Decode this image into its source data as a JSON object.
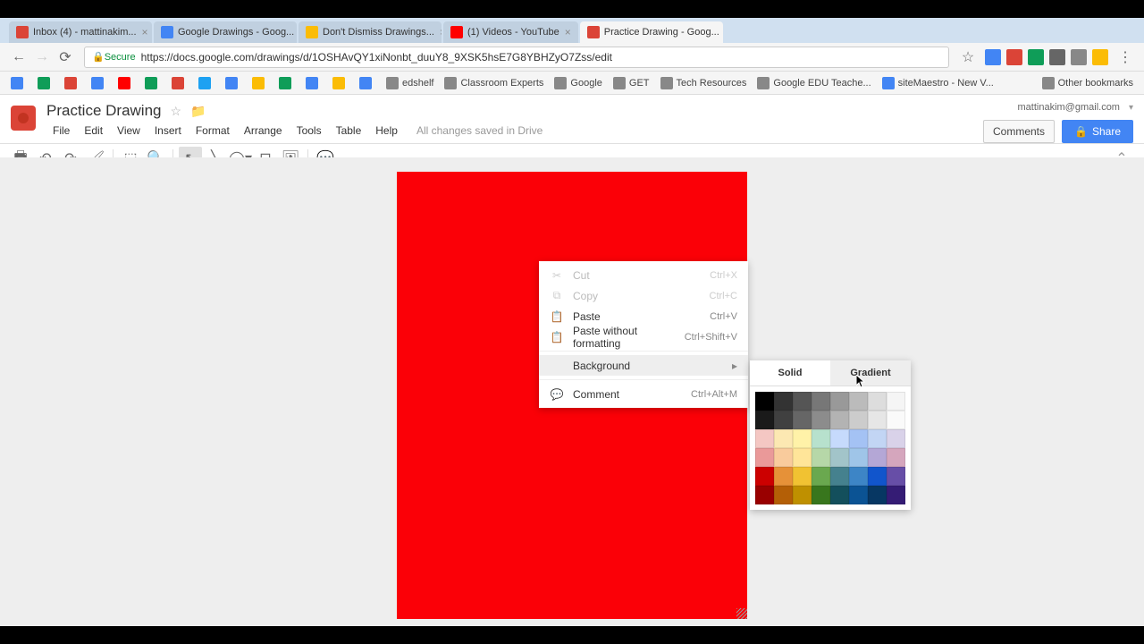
{
  "browser": {
    "tabs": [
      {
        "label": "Inbox (4) - mattinakim...",
        "favicon": "#db4437"
      },
      {
        "label": "Google Drawings - Goog...",
        "favicon": "#4285f4"
      },
      {
        "label": "Don't Dismiss Drawings...",
        "favicon": "#fbbc05"
      },
      {
        "label": "(1) Videos - YouTube",
        "favicon": "#ff0000"
      },
      {
        "label": "Practice Drawing - Goog...",
        "favicon": "#db4437",
        "active": true
      }
    ],
    "secure_label": "Secure",
    "url": "https://docs.google.com/drawings/d/1OSHAvQY1xiNonbt_duuY8_9XSK5hsE7G8YBHZyO7Zss/edit",
    "bookmarks": [
      {
        "label": "",
        "color": "#4285f4"
      },
      {
        "label": "",
        "color": "#0f9d58"
      },
      {
        "label": "",
        "color": "#db4437"
      },
      {
        "label": "",
        "color": "#4285f4"
      },
      {
        "label": "",
        "color": "#ff0000"
      },
      {
        "label": "",
        "color": "#0f9d58"
      },
      {
        "label": "",
        "color": "#db4437"
      },
      {
        "label": "",
        "color": "#1da1f2"
      },
      {
        "label": "",
        "color": "#4285f4"
      },
      {
        "label": "",
        "color": "#fbbc05"
      },
      {
        "label": "",
        "color": "#0f9d58"
      },
      {
        "label": "",
        "color": "#4285f4"
      },
      {
        "label": "",
        "color": "#fbbc05"
      },
      {
        "label": "",
        "color": "#4285f4"
      },
      {
        "label": "edshelf",
        "color": "#888"
      },
      {
        "label": "Classroom Experts",
        "color": "#888"
      },
      {
        "label": "Google",
        "color": "#888"
      },
      {
        "label": "GET",
        "color": "#888"
      },
      {
        "label": "Tech Resources",
        "color": "#888"
      },
      {
        "label": "Google EDU Teache...",
        "color": "#888"
      },
      {
        "label": "siteMaestro - New V...",
        "color": "#4285f4"
      }
    ],
    "other_bookmarks": "Other bookmarks"
  },
  "app": {
    "doc_title": "Practice Drawing",
    "menus": [
      "File",
      "Edit",
      "View",
      "Insert",
      "Format",
      "Arrange",
      "Tools",
      "Table",
      "Help"
    ],
    "save_status": "All changes saved in Drive",
    "user_email": "mattinakim@gmail.com",
    "comments_label": "Comments",
    "share_label": "Share"
  },
  "context_menu": {
    "items": [
      {
        "label": "Cut",
        "shortcut": "Ctrl+X",
        "disabled": true,
        "icon": "cut"
      },
      {
        "label": "Copy",
        "shortcut": "Ctrl+C",
        "disabled": true,
        "icon": "copy"
      },
      {
        "label": "Paste",
        "shortcut": "Ctrl+V",
        "icon": "paste"
      },
      {
        "label": "Paste without formatting",
        "shortcut": "Ctrl+Shift+V",
        "icon": "paste"
      },
      {
        "sep": true
      },
      {
        "label": "Background",
        "submenu": true,
        "hover": true
      },
      {
        "sep": true
      },
      {
        "label": "Comment",
        "shortcut": "Ctrl+Alt+M",
        "icon": "comment"
      }
    ]
  },
  "color_picker": {
    "tab_solid": "Solid",
    "tab_gradient": "Gradient",
    "rows": [
      [
        "#000000",
        "#333333",
        "#555555",
        "#777777",
        "#999999",
        "#bbbbbb",
        "#dddddd",
        "#f5f5f5"
      ],
      [
        "#1a1a1a",
        "#404040",
        "#666666",
        "#8c8c8c",
        "#b3b3b3",
        "#cccccc",
        "#e6e6e6",
        "#fafafa"
      ],
      [
        "#f4c7c3",
        "#fce8b2",
        "#fff2a8",
        "#b7e1cd",
        "#c6dafc",
        "#a4c2f4",
        "#c2d5f4",
        "#d9d2e9"
      ],
      [
        "#ea9999",
        "#f9cb9c",
        "#ffe599",
        "#b6d7a8",
        "#a2c4c9",
        "#9fc5e8",
        "#b4a7d6",
        "#d5a6bd"
      ],
      [
        "#cc0000",
        "#e69138",
        "#f1c232",
        "#6aa84f",
        "#45818e",
        "#3d85c6",
        "#1155cc",
        "#674ea7"
      ],
      [
        "#990000",
        "#b45f06",
        "#bf9000",
        "#38761d",
        "#134f5c",
        "#0b5394",
        "#073763",
        "#351c75"
      ]
    ]
  }
}
